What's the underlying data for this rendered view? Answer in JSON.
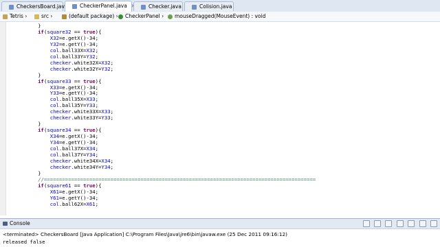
{
  "tabs": [
    {
      "label": "CheckersBoard.java",
      "active": false
    },
    {
      "label": "CheckerPanel.java",
      "active": true
    },
    {
      "label": "Checker.java",
      "active": false
    },
    {
      "label": "Colision.java",
      "active": false
    }
  ],
  "breadcrumb": {
    "project": "Tetris",
    "folder": "src",
    "package": "(default package)",
    "class": "CheckerPanel",
    "method": "mouseDragged(MouseEvent) : void"
  },
  "code_lines": [
    "        }",
    "        if(square32 == true){",
    "            X32=e.getX()-34;",
    "            Y32=e.getY()-34;",
    "            col.ball33X=X32;",
    "            col.ball33Y=Y32;",
    "            checker.white32X=X32;",
    "            checker.white32Y=Y32;",
    "        }",
    "        if(square33 == true){",
    "            X33=e.getX()-34;",
    "            Y33=e.getY()-34;",
    "            col.ball35X=X33;",
    "            col.ball35Y=Y33;",
    "            checker.white33X=X33;",
    "            checker.white33Y=Y33;",
    "        }",
    "        if(square34 == true){",
    "            X34=e.getX()-34;",
    "            Y34=e.getY()-34;",
    "            col.ball37X=X34;",
    "            col.ball37Y=Y34;",
    "            checker.white34X=X34;",
    "            checker.white34Y=Y34;",
    "        }",
    "        //==========================================================================================",
    "        if(square61 == true){",
    "            X61=e.getX()-34;",
    "            Y61=e.getY()-34;",
    "            col.ball62X=X61;"
  ],
  "console": {
    "title": "Console",
    "status": "<terminated> CheckersBoard [Java Application] C:\\Program Files\\Java\\jre6\\bin\\javaw.exe (25 Dec 2011 09:16:12)",
    "output": "released false"
  },
  "colors": {
    "keyword": "#7f0055",
    "field": "#0000c0",
    "comment": "#3f7f5f"
  }
}
